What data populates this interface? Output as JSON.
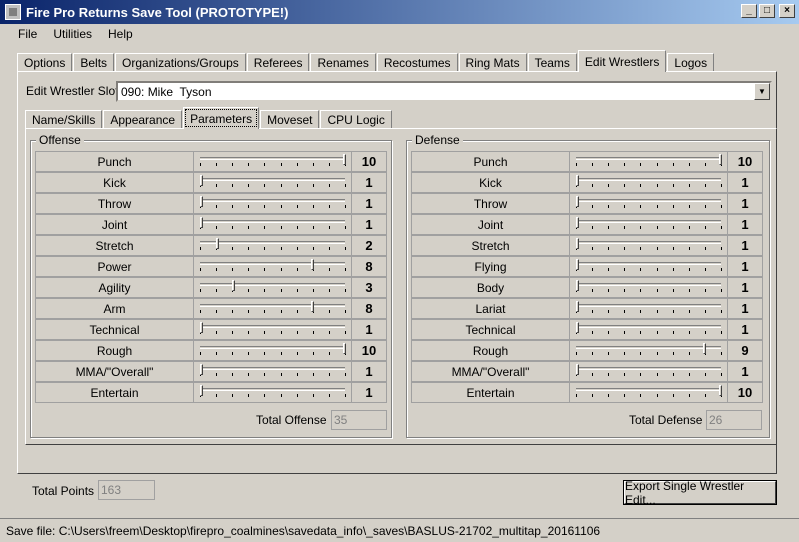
{
  "window": {
    "title": "Fire Pro Returns Save Tool (PROTOTYPE!)"
  },
  "menu": [
    "File",
    "Utilities",
    "Help"
  ],
  "main_tabs": [
    "Options",
    "Belts",
    "Organizations/Groups",
    "Referees",
    "Renames",
    "Recostumes",
    "Ring Mats",
    "Teams",
    "Edit Wrestlers",
    "Logos"
  ],
  "main_tab_active": "Edit Wrestlers",
  "slot": {
    "label": "Edit Wrestler Slot",
    "value": "090: Mike  Tyson"
  },
  "sub_tabs": [
    "Name/Skills",
    "Appearance",
    "Parameters",
    "Moveset",
    "CPU Logic"
  ],
  "sub_tab_active": "Parameters",
  "offense": {
    "title": "Offense",
    "rows": [
      {
        "label": "Punch",
        "value": "10"
      },
      {
        "label": "Kick",
        "value": "1"
      },
      {
        "label": "Throw",
        "value": "1"
      },
      {
        "label": "Joint",
        "value": "1"
      },
      {
        "label": "Stretch",
        "value": "2"
      },
      {
        "label": "Power",
        "value": "8"
      },
      {
        "label": "Agility",
        "value": "3"
      },
      {
        "label": "Arm",
        "value": "8"
      },
      {
        "label": "Technical",
        "value": "1"
      },
      {
        "label": "Rough",
        "value": "10"
      },
      {
        "label": "MMA/\"Overall\"",
        "value": "1"
      },
      {
        "label": "Entertain",
        "value": "1"
      }
    ],
    "total_label": "Total Offense",
    "total_value": "35"
  },
  "defense": {
    "title": "Defense",
    "rows": [
      {
        "label": "Punch",
        "value": "10"
      },
      {
        "label": "Kick",
        "value": "1"
      },
      {
        "label": "Throw",
        "value": "1"
      },
      {
        "label": "Joint",
        "value": "1"
      },
      {
        "label": "Stretch",
        "value": "1"
      },
      {
        "label": "Flying",
        "value": "1"
      },
      {
        "label": "Body",
        "value": "1"
      },
      {
        "label": "Lariat",
        "value": "1"
      },
      {
        "label": "Technical",
        "value": "1"
      },
      {
        "label": "Rough",
        "value": "9"
      },
      {
        "label": "MMA/\"Overall\"",
        "value": "1"
      },
      {
        "label": "Entertain",
        "value": "10"
      }
    ],
    "total_label": "Total Defense",
    "total_value": "26"
  },
  "total_points": {
    "label": "Total Points",
    "value": "163"
  },
  "export_button": "Export Single Wrestler Edit...",
  "status": "Save file: C:\\Users\\freem\\Desktop\\firepro_coalmines\\savedata_info\\_saves\\BASLUS-21702_multitap_20161106",
  "slider_range": [
    1,
    10
  ]
}
